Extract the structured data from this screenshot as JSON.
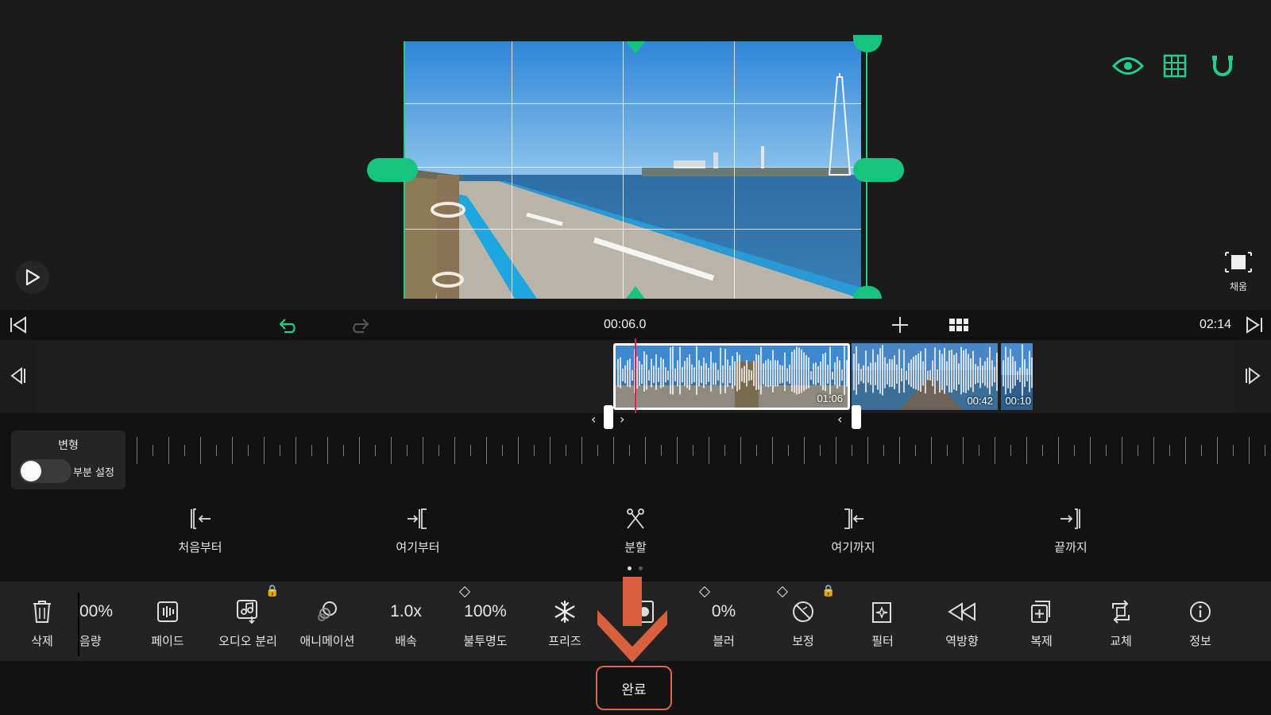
{
  "preview": {
    "fill_label": "채움",
    "colors": {
      "accent": "#1fcf8a",
      "playhead": "#e0204f",
      "arrow": "#d9603f"
    }
  },
  "timebar": {
    "current_time": "00:06.0",
    "total_time": "02:14"
  },
  "timeline": {
    "clips": [
      {
        "duration": "01:06",
        "selected": true
      },
      {
        "duration": "00:42",
        "selected": false
      },
      {
        "duration": "00:10",
        "selected": false
      }
    ]
  },
  "transform_panel": {
    "title": "변형",
    "toggle_label": "부분 설정",
    "toggle_on": false
  },
  "actions": [
    {
      "label": "처음부터",
      "icon": "trim-from-start-icon"
    },
    {
      "label": "여기부터",
      "icon": "trim-from-here-icon"
    },
    {
      "label": "분할",
      "icon": "split-scissors-icon"
    },
    {
      "label": "여기까지",
      "icon": "trim-to-here-icon"
    },
    {
      "label": "끝까지",
      "icon": "trim-to-end-icon"
    }
  ],
  "toolbar": {
    "items": [
      {
        "label": "삭제",
        "value": "",
        "icon": "trash-icon"
      },
      {
        "label": "음량",
        "value": "00%",
        "icon": ""
      },
      {
        "label": "페이드",
        "value": "",
        "icon": "fade-icon"
      },
      {
        "label": "오디오 분리",
        "value": "",
        "icon": "audio-separate-icon",
        "locked": true
      },
      {
        "label": "애니메이션",
        "value": "",
        "icon": "animation-icon"
      },
      {
        "label": "배속",
        "value": "1.0x",
        "icon": ""
      },
      {
        "label": "불투명도",
        "value": "100%",
        "icon": "",
        "keyframe": true
      },
      {
        "label": "프리즈",
        "value": "",
        "icon": "snowflake-icon"
      },
      {
        "label": "",
        "value": "",
        "icon": "mask-icon"
      },
      {
        "label": "블러",
        "value": "0%",
        "icon": "",
        "keyframe": true
      },
      {
        "label": "보정",
        "value": "",
        "icon": "adjust-icon",
        "keyframe": true,
        "locked": true
      },
      {
        "label": "필터",
        "value": "",
        "icon": "filter-icon"
      },
      {
        "label": "역방향",
        "value": "",
        "icon": "reverse-icon"
      },
      {
        "label": "복제",
        "value": "",
        "icon": "duplicate-icon"
      },
      {
        "label": "교체",
        "value": "",
        "icon": "replace-icon"
      },
      {
        "label": "정보",
        "value": "",
        "icon": "info-icon"
      }
    ]
  },
  "footer": {
    "done_label": "완료"
  }
}
